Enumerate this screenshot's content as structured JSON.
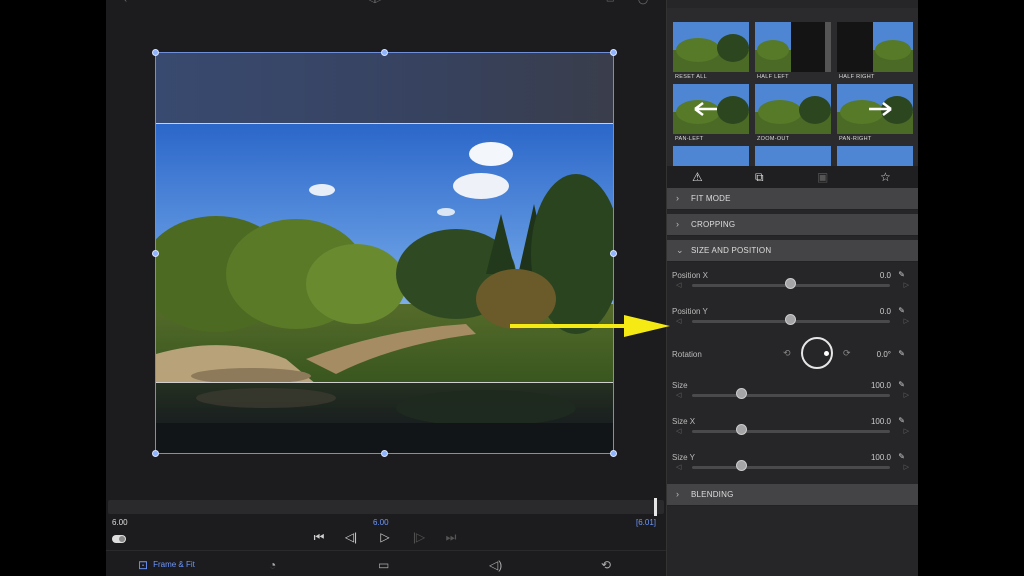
{
  "viewer": {
    "timecode_left": "6.00",
    "timecode_mid": "6.00",
    "timecode_right": "[6.01]"
  },
  "bottom_tabs": {
    "frame_fit_label": "Frame & Fit"
  },
  "presets": [
    {
      "label": "RESET ALL"
    },
    {
      "label": "HALF LEFT"
    },
    {
      "label": "HALF RIGHT"
    },
    {
      "label": "PAN-LEFT"
    },
    {
      "label": "ZOOM-OUT"
    },
    {
      "label": "PAN-RIGHT"
    }
  ],
  "sections": {
    "fit_mode": "FIT MODE",
    "cropping": "CROPPING",
    "size_position": "SIZE AND POSITION",
    "blending": "BLENDING"
  },
  "params": {
    "position_x": {
      "label": "Position X",
      "value": "0.0",
      "level": 0.5
    },
    "position_y": {
      "label": "Position Y",
      "value": "0.0",
      "level": 0.5
    },
    "rotation": {
      "label": "Rotation",
      "value": "0.0°"
    },
    "size": {
      "label": "Size",
      "value": "100.0",
      "level": 0.25
    },
    "size_x": {
      "label": "Size X",
      "value": "100.0",
      "level": 0.25
    },
    "size_y": {
      "label": "Size Y",
      "value": "100.0",
      "level": 0.25
    }
  },
  "colors": {
    "accent": "#6d97ff",
    "arrow": "#f5ea14"
  }
}
